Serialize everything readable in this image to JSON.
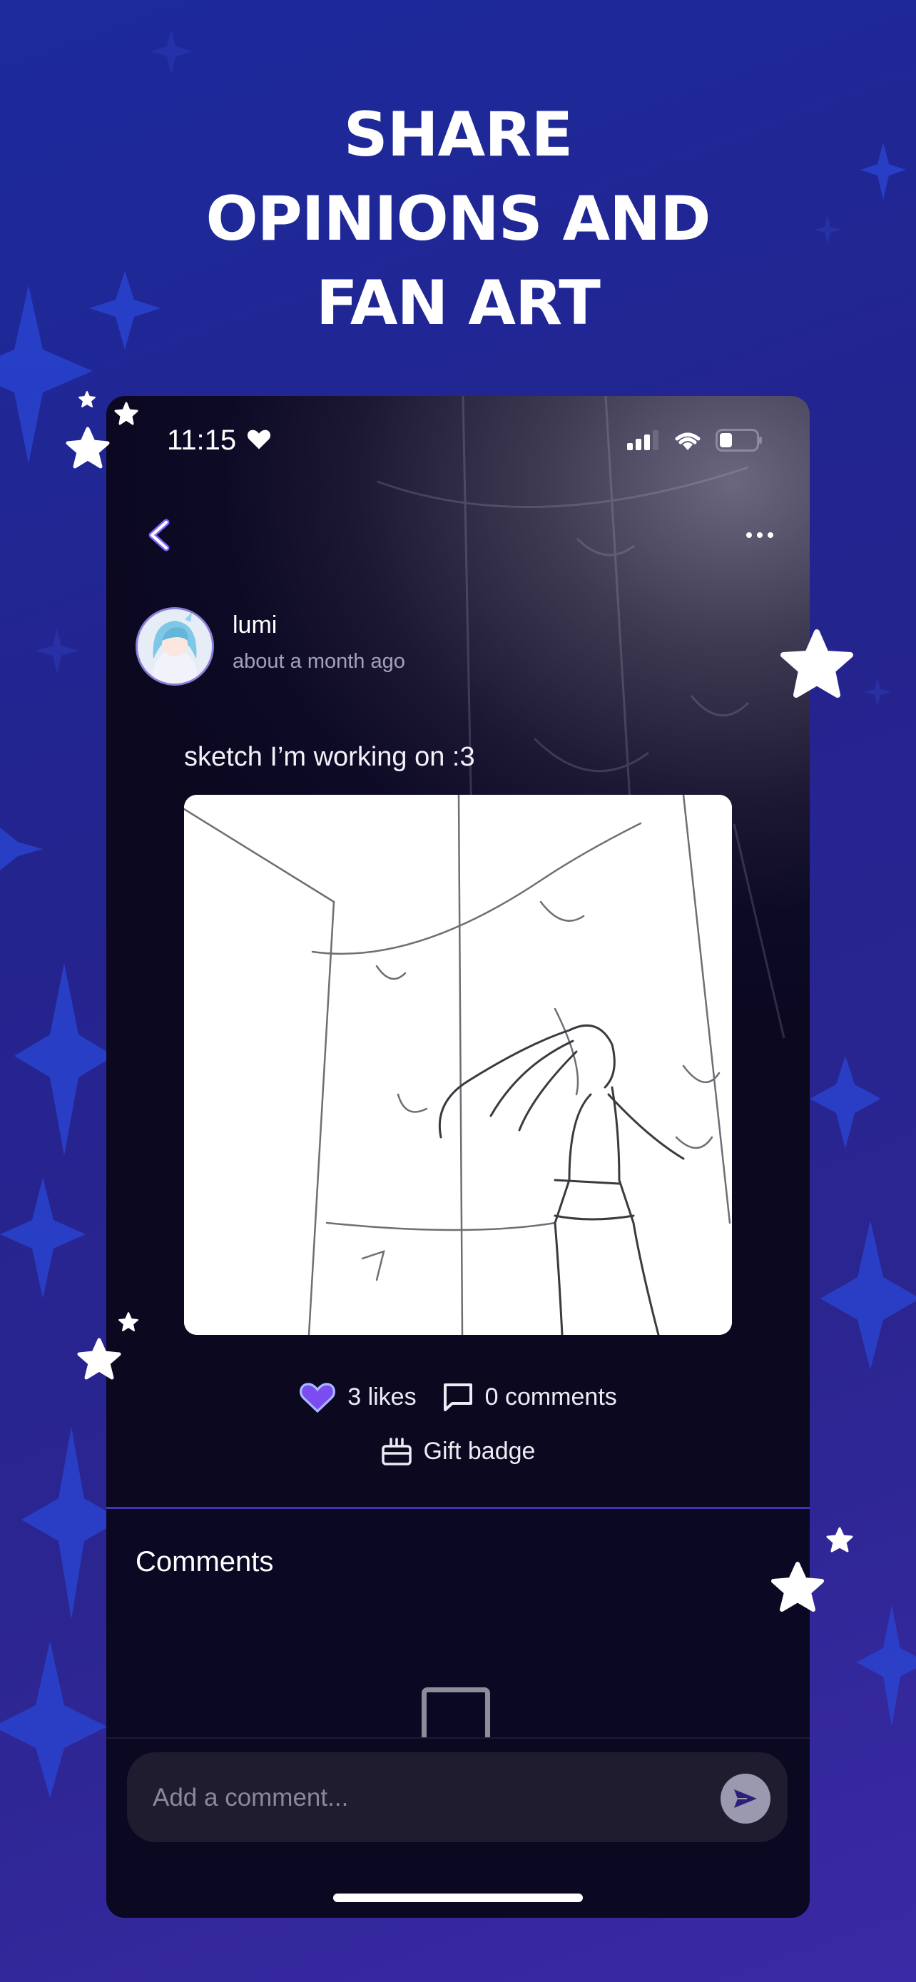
{
  "headline": {
    "line1": "SHARE",
    "line2": "OPINIONS AND",
    "line3": "FAN ART"
  },
  "status_bar": {
    "time": "11:15",
    "icons": [
      "heart-icon",
      "signal-icon",
      "wifi-icon",
      "battery-icon"
    ]
  },
  "nav": {
    "back_icon": "chevron-left-icon",
    "more_icon": "ellipsis-icon"
  },
  "post": {
    "author": "lumi",
    "posted": "about a month ago",
    "text": "sketch I’m working on :3",
    "likes": "3 likes",
    "comments": "0 comments",
    "gift": "Gift badge"
  },
  "comments_section": {
    "title": "Comments"
  },
  "composer": {
    "placeholder": "Add a comment..."
  },
  "colors": {
    "background": "#23248f",
    "accent": "#7b5cf0",
    "divider": "#3f35b8"
  }
}
